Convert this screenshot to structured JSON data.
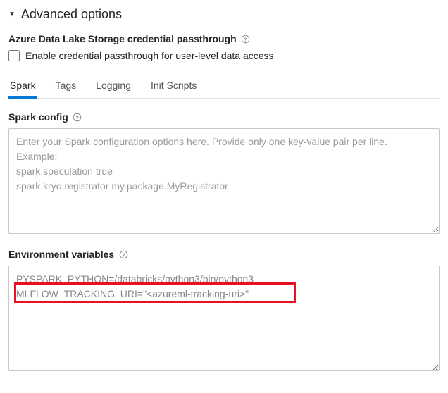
{
  "section": {
    "title": "Advanced options"
  },
  "passthrough": {
    "label": "Azure Data Lake Storage credential passthrough",
    "checkbox_label": "Enable credential passthrough for user-level data access"
  },
  "tabs": {
    "spark": "Spark",
    "tags": "Tags",
    "logging": "Logging",
    "init_scripts": "Init Scripts"
  },
  "spark_config": {
    "label": "Spark config",
    "placeholder": "Enter your Spark configuration options here. Provide only one key-value pair per line.\nExample:\nspark.speculation true\nspark.kryo.registrator my.package.MyRegistrator"
  },
  "env_vars": {
    "label": "Environment variables",
    "value": "PYSPARK_PYTHON=/databricks/python3/bin/python3\nMLFLOW_TRACKING_URI=\"<azureml-tracking-uri>\""
  }
}
